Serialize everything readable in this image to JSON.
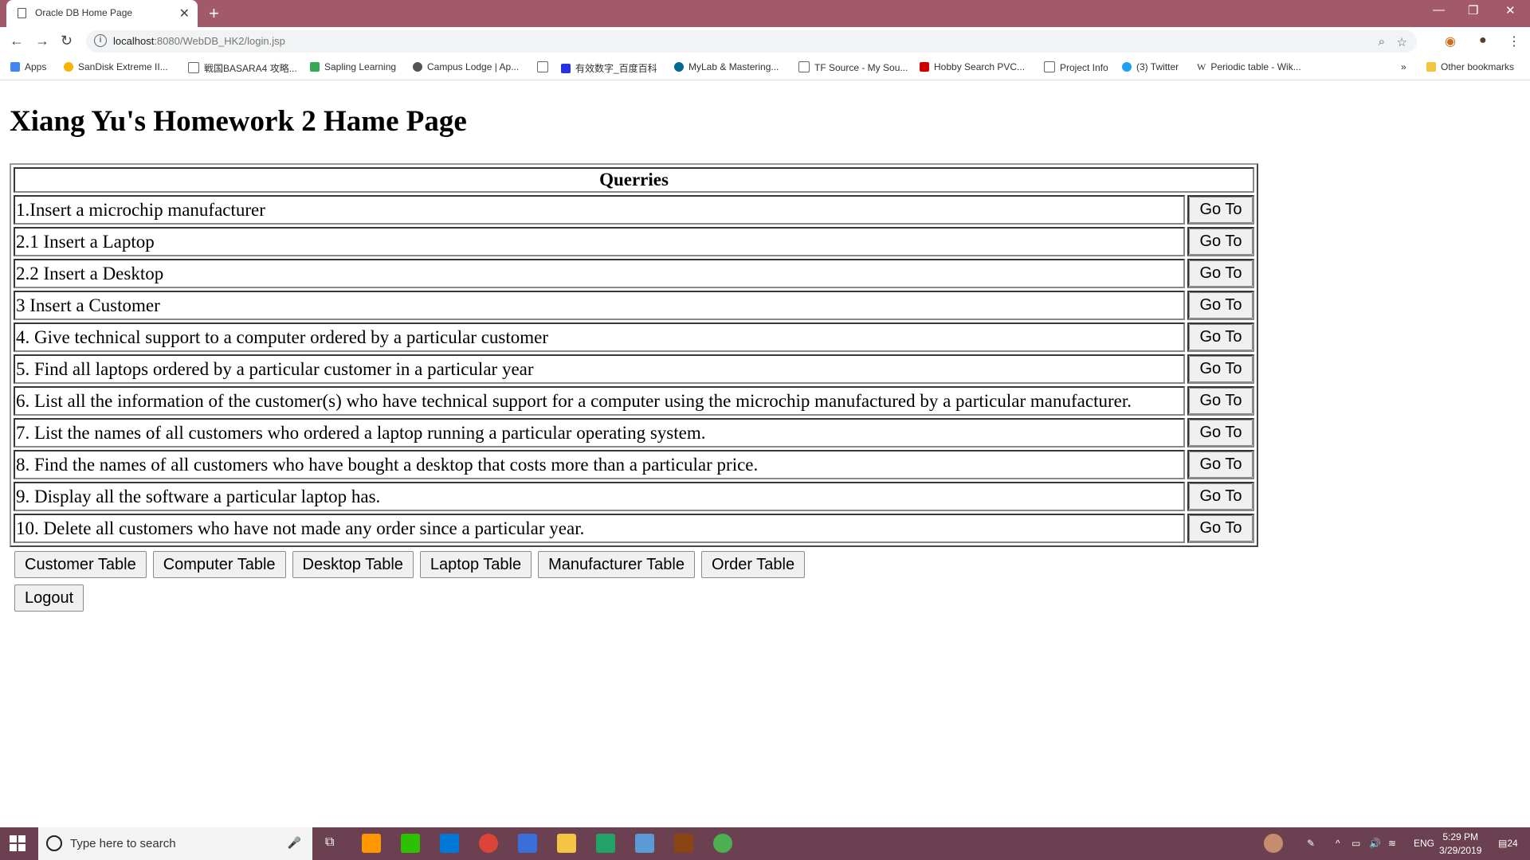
{
  "browser": {
    "tab_title": "Oracle DB Home Page",
    "url_host": "localhost",
    "url_rest": ":8080/WebDB_HK2/login.jsp",
    "bookmarks": [
      {
        "label": "Apps",
        "color": "#4285f4"
      },
      {
        "label": "SanDisk Extreme II...",
        "color": "#f4b400"
      },
      {
        "label": "戦国BASARA4 攻略...",
        "color": "#ffffff"
      },
      {
        "label": "Sapling Learning",
        "color": "#34a853"
      },
      {
        "label": "Campus Lodge | Ap...",
        "color": "#555555"
      },
      {
        "label": "",
        "color": "#ffffff"
      },
      {
        "label": "有效数字_百度百科",
        "color": "#2932e1"
      },
      {
        "label": "MyLab & Mastering...",
        "color": "#006b8f"
      },
      {
        "label": "TF Source - My Sou...",
        "color": "#ffffff"
      },
      {
        "label": "Hobby Search PVC...",
        "color": "#d00000"
      },
      {
        "label": "Project Info",
        "color": "#ffffff"
      },
      {
        "label": "(3) Twitter",
        "color": "#1da1f2"
      },
      {
        "label": "Periodic table - Wik...",
        "color": "#ffffff"
      }
    ],
    "overflow": "»",
    "other_bookmarks": "Other bookmarks"
  },
  "page": {
    "heading": "Xiang Yu's Homework 2 Hame Page",
    "table_header": "Querries",
    "go_label": "Go To",
    "queries": [
      "1.Insert a microchip manufacturer",
      "2.1 Insert a Laptop",
      "2.2 Insert a Desktop",
      "3 Insert a Customer",
      "4. Give technical support to a computer ordered by a particular customer",
      "5. Find all laptops ordered by a particular customer in a particular year",
      "6. List all the information of the customer(s) who have technical support for a computer using the microchip manufactured by a particular manufacturer.",
      "7. List the names of all customers who ordered a laptop running a particular operating system.",
      "8. Find the names of all customers who have bought a desktop that costs more than a particular price.",
      "9. Display all the software a particular laptop has.",
      "10. Delete all customers who have not made any order since a particular year."
    ],
    "table_buttons": [
      "Customer Table",
      "Computer Table",
      "Desktop Table",
      "Laptop Table",
      "Manufacturer Table",
      "Order Table"
    ],
    "logout": "Logout"
  },
  "taskbar": {
    "search_placeholder": "Type here to search",
    "lang": "ENG",
    "time": "5:29 PM",
    "date": "3/29/2019",
    "notifications": "24"
  },
  "colors": {
    "titlebar": "#a2596a",
    "taskbar": "#6b4151"
  }
}
